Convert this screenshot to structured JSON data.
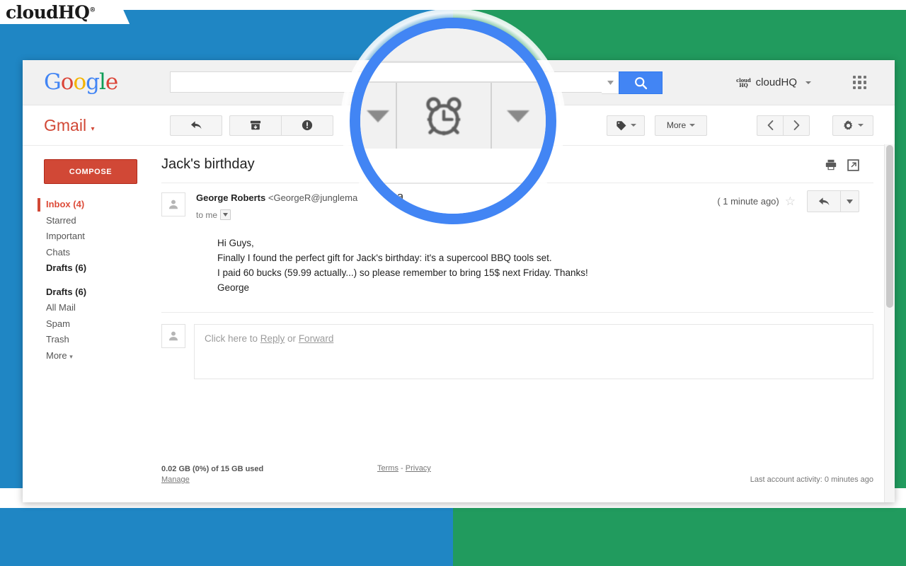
{
  "brand": {
    "logo_text": "cloudHQ",
    "logo_registered": "®"
  },
  "background": {
    "left_color": "#1f86c4",
    "right_color": "#219b5e",
    "accent_blue": "#4285f4"
  },
  "google_bar": {
    "logo_letters": [
      "G",
      "o",
      "o",
      "g",
      "l",
      "e"
    ],
    "search": {
      "value": "",
      "placeholder": "",
      "caret_icon": "chevron-down-icon",
      "button_icon": "search-icon"
    },
    "account": {
      "badge_line1": "cloud",
      "badge_line2": "HQ",
      "badge_registered": "°",
      "name": "cloudHQ",
      "caret": "▾"
    },
    "apps_icon": "apps-grid-icon"
  },
  "toolbar": {
    "brand": "Gmail",
    "brand_caret": "▾",
    "buttons": [
      {
        "name": "back-to-inbox-button",
        "icon": "back-arrow-icon",
        "label": ""
      },
      {
        "name": "archive-button",
        "icon": "archive-icon",
        "label": ""
      },
      {
        "name": "report-spam-button",
        "icon": "spam-exclamation-icon",
        "label": ""
      },
      {
        "name": "labels-button",
        "icon": "label-tag-icon",
        "label": ""
      },
      {
        "name": "more-button",
        "icon": "",
        "label": "More"
      }
    ],
    "more_label": "More",
    "nav": {
      "prev_icon": "chevron-left-icon",
      "next_icon": "chevron-right-icon"
    },
    "settings_icon": "gear-icon"
  },
  "sidebar": {
    "compose_label": "COMPOSE",
    "folders": [
      {
        "label": "Inbox (4)",
        "state": "active"
      },
      {
        "label": "Starred",
        "state": "normal"
      },
      {
        "label": "Important",
        "state": "normal"
      },
      {
        "label": "Chats",
        "state": "normal"
      },
      {
        "label": "Drafts (6)",
        "state": "bold"
      },
      {
        "label": "Drafts (6)",
        "state": "bold-gap"
      },
      {
        "label": "All Mail",
        "state": "normal"
      },
      {
        "label": "Spam",
        "state": "normal"
      },
      {
        "label": "Trash",
        "state": "normal"
      },
      {
        "label": "More",
        "state": "more"
      }
    ],
    "more_caret": "▾"
  },
  "message": {
    "subject": "Jack's birthday",
    "print_icon": "printer-icon",
    "popout_icon": "open-in-new-window-icon",
    "sender_name": "George Roberts",
    "sender_address": "<GeorgeR@junglema",
    "time": "( 1 minute ago)",
    "star_icon": "star-outline-icon",
    "to_line": "to me",
    "to_caret": "▾",
    "reply_icon": "reply-arrow-icon",
    "reply_caret": "▾",
    "body": [
      "Hi Guys,",
      "Finally I found the perfect gift for Jack's birthday: it's a supercool BBQ tools set.",
      "I paid 60 bucks (59.99 actually...) so please remember to bring 15$ next Friday. Thanks!"
    ],
    "signature": "George"
  },
  "reply_box": {
    "prefix": "Click here to ",
    "reply_link": "Reply",
    "middle": " or ",
    "forward_link": "Forward"
  },
  "footer": {
    "storage": "0.02 GB (0%) of 15 GB used",
    "manage": "Manage",
    "terms": "Terms",
    "separator": "-",
    "privacy": "Privacy",
    "activity": "Last account activity: 0 minutes ago"
  },
  "magnifier": {
    "focus_icon": "alarm-clock-snooze-icon",
    "left_caret_icon": "chevron-down-icon",
    "right_caret_icon": "chevron-down-icon",
    "ring_color": "#4285f4",
    "visible_text_left": "unglema",
    "visible_text_right": "( 1 min"
  }
}
